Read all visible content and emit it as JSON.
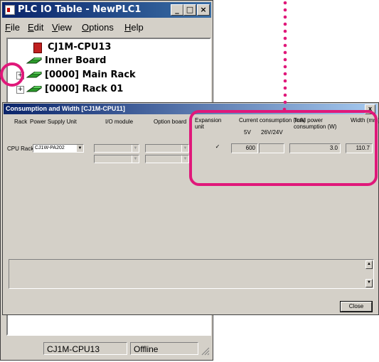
{
  "plc_window": {
    "title": "PLC IO Table - NewPLC1",
    "title_icon": "plc-io-table-icon",
    "controls": [
      "minimize",
      "maximize",
      "close"
    ],
    "menu": [
      {
        "label": "File",
        "mnemonic": "F"
      },
      {
        "label": "Edit",
        "mnemonic": "E"
      },
      {
        "label": "View",
        "mnemonic": "V"
      },
      {
        "label": "Options",
        "mnemonic": "O"
      },
      {
        "label": "Help",
        "mnemonic": "H"
      }
    ],
    "tree": [
      {
        "label": "CJ1M-CPU13",
        "icon": "cpu-icon"
      },
      {
        "label": "Inner Board",
        "icon": "rack-icon"
      },
      {
        "label": "[0000] Main Rack",
        "icon": "rack-icon",
        "expander": "+"
      },
      {
        "label": "[0000] Rack 01",
        "icon": "rack-icon",
        "expander": "+"
      }
    ],
    "status": {
      "device": "CJ1M-CPU13",
      "mode": "Offline"
    }
  },
  "dialog": {
    "title": "Consumption and Width [CJ1M-CPU11]",
    "close_glyph": "x",
    "headers": {
      "rack": "Rack",
      "power_supply": "Power Supply Unit",
      "io_module": "I/O module",
      "option_board": "Option board",
      "expansion": "Expansion\nunit",
      "current_consumption": "Current consumption (mA)",
      "v5": "5V",
      "v24": "26V/24V",
      "total_power": "Total power\nconsumption (W)",
      "width": "Width (mm)"
    },
    "row": {
      "rack_label": "CPU Rack",
      "power_supply_value": "CJ1W-PA202",
      "expansion_checked": "✓",
      "current_5v": "600",
      "current_24v": "",
      "total_power": "3.0",
      "width": "110.7"
    },
    "close_button": "Close"
  },
  "colors": {
    "annotation": "#e0187a",
    "titlebar": "#0a246a",
    "face": "#d4d0c8"
  }
}
